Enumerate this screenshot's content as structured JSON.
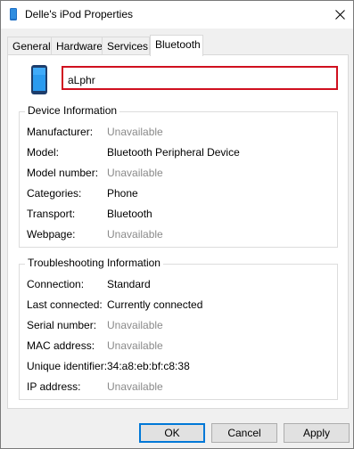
{
  "window": {
    "title": "Delle's iPod Properties",
    "title_icon": "device-icon",
    "close_icon": "close-icon"
  },
  "tabs": [
    {
      "label": "General",
      "active": false
    },
    {
      "label": "Hardware",
      "active": false
    },
    {
      "label": "Services",
      "active": false
    },
    {
      "label": "Bluetooth",
      "active": true
    }
  ],
  "device": {
    "icon": "phone-icon",
    "name_value": "aLphr",
    "highlight_color": "#d0101f"
  },
  "device_info": {
    "title": "Device Information",
    "rows": [
      {
        "label": "Manufacturer:",
        "value": "Unavailable",
        "muted": true
      },
      {
        "label": "Model:",
        "value": "Bluetooth Peripheral Device",
        "muted": false
      },
      {
        "label": "Model number:",
        "value": "Unavailable",
        "muted": true
      },
      {
        "label": "Categories:",
        "value": "Phone",
        "muted": false
      },
      {
        "label": "Transport:",
        "value": "Bluetooth",
        "muted": false
      },
      {
        "label": "Webpage:",
        "value": "Unavailable",
        "muted": true
      }
    ]
  },
  "troubleshooting": {
    "title": "Troubleshooting Information",
    "rows": [
      {
        "label": "Connection:",
        "value": "Standard",
        "muted": false
      },
      {
        "label": "Last connected:",
        "value": "Currently connected",
        "muted": false
      },
      {
        "label": "Serial number:",
        "value": "Unavailable",
        "muted": true
      },
      {
        "label": "MAC address:",
        "value": "Unavailable",
        "muted": true
      },
      {
        "label": "Unique identifier:",
        "value": "34:a8:eb:bf:c8:38",
        "muted": false
      },
      {
        "label": "IP address:",
        "value": "Unavailable",
        "muted": true
      }
    ]
  },
  "buttons": {
    "ok": "OK",
    "cancel": "Cancel",
    "apply": "Apply"
  },
  "colors": {
    "accent": "#0078d7",
    "muted_text": "#8a8a8a"
  }
}
